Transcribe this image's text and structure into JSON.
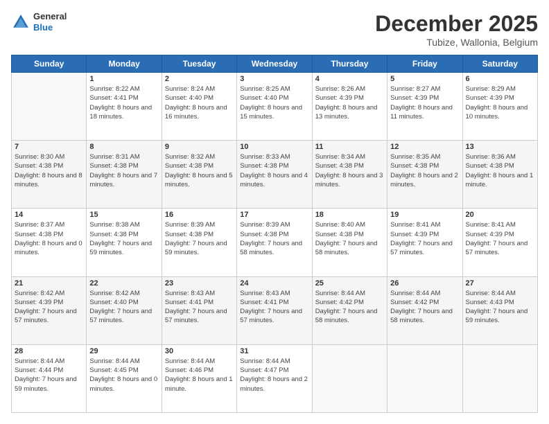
{
  "logo": {
    "general": "General",
    "blue": "Blue"
  },
  "header": {
    "month_year": "December 2025",
    "location": "Tubize, Wallonia, Belgium"
  },
  "weekdays": [
    "Sunday",
    "Monday",
    "Tuesday",
    "Wednesday",
    "Thursday",
    "Friday",
    "Saturday"
  ],
  "weeks": [
    [
      {
        "day": "",
        "sunrise": "",
        "sunset": "",
        "daylight": ""
      },
      {
        "day": "1",
        "sunrise": "Sunrise: 8:22 AM",
        "sunset": "Sunset: 4:41 PM",
        "daylight": "Daylight: 8 hours and 18 minutes."
      },
      {
        "day": "2",
        "sunrise": "Sunrise: 8:24 AM",
        "sunset": "Sunset: 4:40 PM",
        "daylight": "Daylight: 8 hours and 16 minutes."
      },
      {
        "day": "3",
        "sunrise": "Sunrise: 8:25 AM",
        "sunset": "Sunset: 4:40 PM",
        "daylight": "Daylight: 8 hours and 15 minutes."
      },
      {
        "day": "4",
        "sunrise": "Sunrise: 8:26 AM",
        "sunset": "Sunset: 4:39 PM",
        "daylight": "Daylight: 8 hours and 13 minutes."
      },
      {
        "day": "5",
        "sunrise": "Sunrise: 8:27 AM",
        "sunset": "Sunset: 4:39 PM",
        "daylight": "Daylight: 8 hours and 11 minutes."
      },
      {
        "day": "6",
        "sunrise": "Sunrise: 8:29 AM",
        "sunset": "Sunset: 4:39 PM",
        "daylight": "Daylight: 8 hours and 10 minutes."
      }
    ],
    [
      {
        "day": "7",
        "sunrise": "Sunrise: 8:30 AM",
        "sunset": "Sunset: 4:38 PM",
        "daylight": "Daylight: 8 hours and 8 minutes."
      },
      {
        "day": "8",
        "sunrise": "Sunrise: 8:31 AM",
        "sunset": "Sunset: 4:38 PM",
        "daylight": "Daylight: 8 hours and 7 minutes."
      },
      {
        "day": "9",
        "sunrise": "Sunrise: 8:32 AM",
        "sunset": "Sunset: 4:38 PM",
        "daylight": "Daylight: 8 hours and 5 minutes."
      },
      {
        "day": "10",
        "sunrise": "Sunrise: 8:33 AM",
        "sunset": "Sunset: 4:38 PM",
        "daylight": "Daylight: 8 hours and 4 minutes."
      },
      {
        "day": "11",
        "sunrise": "Sunrise: 8:34 AM",
        "sunset": "Sunset: 4:38 PM",
        "daylight": "Daylight: 8 hours and 3 minutes."
      },
      {
        "day": "12",
        "sunrise": "Sunrise: 8:35 AM",
        "sunset": "Sunset: 4:38 PM",
        "daylight": "Daylight: 8 hours and 2 minutes."
      },
      {
        "day": "13",
        "sunrise": "Sunrise: 8:36 AM",
        "sunset": "Sunset: 4:38 PM",
        "daylight": "Daylight: 8 hours and 1 minute."
      }
    ],
    [
      {
        "day": "14",
        "sunrise": "Sunrise: 8:37 AM",
        "sunset": "Sunset: 4:38 PM",
        "daylight": "Daylight: 8 hours and 0 minutes."
      },
      {
        "day": "15",
        "sunrise": "Sunrise: 8:38 AM",
        "sunset": "Sunset: 4:38 PM",
        "daylight": "Daylight: 7 hours and 59 minutes."
      },
      {
        "day": "16",
        "sunrise": "Sunrise: 8:39 AM",
        "sunset": "Sunset: 4:38 PM",
        "daylight": "Daylight: 7 hours and 59 minutes."
      },
      {
        "day": "17",
        "sunrise": "Sunrise: 8:39 AM",
        "sunset": "Sunset: 4:38 PM",
        "daylight": "Daylight: 7 hours and 58 minutes."
      },
      {
        "day": "18",
        "sunrise": "Sunrise: 8:40 AM",
        "sunset": "Sunset: 4:38 PM",
        "daylight": "Daylight: 7 hours and 58 minutes."
      },
      {
        "day": "19",
        "sunrise": "Sunrise: 8:41 AM",
        "sunset": "Sunset: 4:39 PM",
        "daylight": "Daylight: 7 hours and 57 minutes."
      },
      {
        "day": "20",
        "sunrise": "Sunrise: 8:41 AM",
        "sunset": "Sunset: 4:39 PM",
        "daylight": "Daylight: 7 hours and 57 minutes."
      }
    ],
    [
      {
        "day": "21",
        "sunrise": "Sunrise: 8:42 AM",
        "sunset": "Sunset: 4:39 PM",
        "daylight": "Daylight: 7 hours and 57 minutes."
      },
      {
        "day": "22",
        "sunrise": "Sunrise: 8:42 AM",
        "sunset": "Sunset: 4:40 PM",
        "daylight": "Daylight: 7 hours and 57 minutes."
      },
      {
        "day": "23",
        "sunrise": "Sunrise: 8:43 AM",
        "sunset": "Sunset: 4:41 PM",
        "daylight": "Daylight: 7 hours and 57 minutes."
      },
      {
        "day": "24",
        "sunrise": "Sunrise: 8:43 AM",
        "sunset": "Sunset: 4:41 PM",
        "daylight": "Daylight: 7 hours and 57 minutes."
      },
      {
        "day": "25",
        "sunrise": "Sunrise: 8:44 AM",
        "sunset": "Sunset: 4:42 PM",
        "daylight": "Daylight: 7 hours and 58 minutes."
      },
      {
        "day": "26",
        "sunrise": "Sunrise: 8:44 AM",
        "sunset": "Sunset: 4:42 PM",
        "daylight": "Daylight: 7 hours and 58 minutes."
      },
      {
        "day": "27",
        "sunrise": "Sunrise: 8:44 AM",
        "sunset": "Sunset: 4:43 PM",
        "daylight": "Daylight: 7 hours and 59 minutes."
      }
    ],
    [
      {
        "day": "28",
        "sunrise": "Sunrise: 8:44 AM",
        "sunset": "Sunset: 4:44 PM",
        "daylight": "Daylight: 7 hours and 59 minutes."
      },
      {
        "day": "29",
        "sunrise": "Sunrise: 8:44 AM",
        "sunset": "Sunset: 4:45 PM",
        "daylight": "Daylight: 8 hours and 0 minutes."
      },
      {
        "day": "30",
        "sunrise": "Sunrise: 8:44 AM",
        "sunset": "Sunset: 4:46 PM",
        "daylight": "Daylight: 8 hours and 1 minute."
      },
      {
        "day": "31",
        "sunrise": "Sunrise: 8:44 AM",
        "sunset": "Sunset: 4:47 PM",
        "daylight": "Daylight: 8 hours and 2 minutes."
      },
      {
        "day": "",
        "sunrise": "",
        "sunset": "",
        "daylight": ""
      },
      {
        "day": "",
        "sunrise": "",
        "sunset": "",
        "daylight": ""
      },
      {
        "day": "",
        "sunrise": "",
        "sunset": "",
        "daylight": ""
      }
    ]
  ]
}
